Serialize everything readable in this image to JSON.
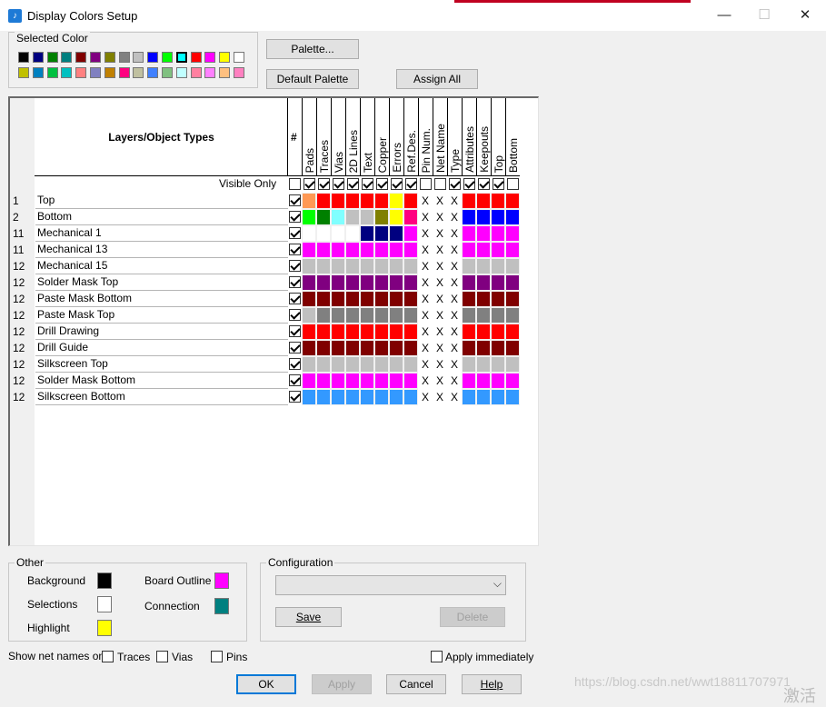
{
  "window": {
    "title": "Display Colors Setup",
    "minimize": "—",
    "maximize": "☐",
    "close": "✕"
  },
  "selected_color": {
    "label": "Selected Color",
    "row1": [
      "#000000",
      "#000080",
      "#008000",
      "#008080",
      "#800000",
      "#800080",
      "#808000",
      "#808080",
      "#c0c0c0",
      "#0000ff",
      "#00ff00",
      "#00ffff",
      "#ff0000",
      "#ff00ff",
      "#ffff00",
      "#ffffff"
    ],
    "row2": [
      "#c0c000",
      "#0080c0",
      "#00c040",
      "#00c0c0",
      "#ff8080",
      "#8080c0",
      "#c08000",
      "#ff0080",
      "#c0c0a0",
      "#4080ff",
      "#80c080",
      "#c0ffff",
      "#ff80a0",
      "#ff80ff",
      "#ffc080",
      "#ff80c0"
    ],
    "selected_index": 11
  },
  "buttons": {
    "palette": "Palette...",
    "default_palette": "Default Palette",
    "assign_all": "Assign All",
    "ok": "OK",
    "apply": "Apply",
    "cancel": "Cancel",
    "help": "Help",
    "save": "Save",
    "delete": "Delete"
  },
  "grid": {
    "header": "Layers/Object Types",
    "hash_col": "#",
    "columns": [
      "Pads",
      "Traces",
      "Vias",
      "2D Lines",
      "Text",
      "Copper",
      "Errors",
      "Ref.Des.",
      "Pin Num.",
      "Net Name",
      "Type",
      "Attributes",
      "Keepouts",
      "Top",
      "Bottom"
    ],
    "visible_only_label": "Visible Only",
    "visible_only_checks": [
      false,
      true,
      true,
      true,
      true,
      true,
      true,
      true,
      true,
      false,
      false,
      true,
      true,
      true,
      true,
      false
    ],
    "rows": [
      {
        "num": "1",
        "name": "Top",
        "checked": true,
        "colors": [
          "#ff9955",
          "#ff0000",
          "#ff0000",
          "#ff0000",
          "#ff0000",
          "#ff0000",
          "#ffff00",
          "#ff0000",
          "X",
          "X",
          "X",
          "#ff0000",
          "#ff0000",
          "#ff0000",
          "#ff0000"
        ]
      },
      {
        "num": "2",
        "name": "Bottom",
        "checked": true,
        "colors": [
          "#00ff00",
          "#008000",
          "#80ffff",
          "#c0c0c0",
          "#c0c0c0",
          "#808000",
          "#ffff00",
          "#ff0080",
          "X",
          "X",
          "X",
          "#0000ff",
          "#0000ff",
          "#0000ff",
          "#0000ff"
        ]
      },
      {
        "num": "11",
        "name": "Mechanical 1",
        "checked": true,
        "colors": [
          "#ffffff",
          "#ffffff",
          "#ffffff",
          "#ffffff",
          "#000080",
          "#000080",
          "#000080",
          "#ff00ff",
          "X",
          "X",
          "X",
          "#ff00ff",
          "#ff00ff",
          "#ff00ff",
          "#ff00ff"
        ]
      },
      {
        "num": "11",
        "name": "Mechanical 13",
        "checked": true,
        "colors": [
          "#ff00ff",
          "#ff00ff",
          "#ff00ff",
          "#ff00ff",
          "#ff00ff",
          "#ff00ff",
          "#ff00ff",
          "#ff00ff",
          "X",
          "X",
          "X",
          "#ff00ff",
          "#ff00ff",
          "#ff00ff",
          "#ff00ff"
        ]
      },
      {
        "num": "12",
        "name": "Mechanical 15",
        "checked": true,
        "colors": [
          "#c0c0c0",
          "#c0c0c0",
          "#c0c0c0",
          "#c0c0c0",
          "#c0c0c0",
          "#c0c0c0",
          "#c0c0c0",
          "#c0c0c0",
          "X",
          "X",
          "X",
          "#c0c0c0",
          "#c0c0c0",
          "#c0c0c0",
          "#c0c0c0"
        ]
      },
      {
        "num": "12",
        "name": "Solder Mask Top",
        "checked": true,
        "colors": [
          "#800080",
          "#800080",
          "#800080",
          "#800080",
          "#800080",
          "#800080",
          "#800080",
          "#800080",
          "X",
          "X",
          "X",
          "#800080",
          "#800080",
          "#800080",
          "#800080"
        ]
      },
      {
        "num": "12",
        "name": "Paste Mask Bottom",
        "checked": true,
        "colors": [
          "#800000",
          "#800000",
          "#800000",
          "#800000",
          "#800000",
          "#800000",
          "#800000",
          "#800000",
          "X",
          "X",
          "X",
          "#800000",
          "#800000",
          "#800000",
          "#800000"
        ]
      },
      {
        "num": "12",
        "name": "Paste Mask Top",
        "checked": true,
        "colors": [
          "#c0c0c0",
          "#808080",
          "#808080",
          "#808080",
          "#808080",
          "#808080",
          "#808080",
          "#808080",
          "X",
          "X",
          "X",
          "#808080",
          "#808080",
          "#808080",
          "#808080"
        ]
      },
      {
        "num": "12",
        "name": "Drill Drawing",
        "checked": true,
        "colors": [
          "#ff0000",
          "#ff0000",
          "#ff0000",
          "#ff0000",
          "#ff0000",
          "#ff0000",
          "#ff0000",
          "#ff0000",
          "X",
          "X",
          "X",
          "#ff0000",
          "#ff0000",
          "#ff0000",
          "#ff0000"
        ]
      },
      {
        "num": "12",
        "name": "Drill Guide",
        "checked": true,
        "colors": [
          "#800000",
          "#800000",
          "#800000",
          "#800000",
          "#800000",
          "#800000",
          "#800000",
          "#800000",
          "X",
          "X",
          "X",
          "#800000",
          "#800000",
          "#800000",
          "#800000"
        ]
      },
      {
        "num": "12",
        "name": "Silkscreen Top",
        "checked": true,
        "colors": [
          "#c0c0c0",
          "#c0c0c0",
          "#c0c0c0",
          "#c0c0c0",
          "#c0c0c0",
          "#c0c0c0",
          "#c0c0c0",
          "#c0c0c0",
          "X",
          "X",
          "X",
          "#c0c0c0",
          "#c0c0c0",
          "#c0c0c0",
          "#c0c0c0"
        ]
      },
      {
        "num": "12",
        "name": "Solder Mask Bottom",
        "checked": true,
        "colors": [
          "#ff00ff",
          "#ff00ff",
          "#ff00ff",
          "#ff00ff",
          "#ff00ff",
          "#ff00ff",
          "#ff00ff",
          "#ff00ff",
          "X",
          "X",
          "X",
          "#ff00ff",
          "#ff00ff",
          "#ff00ff",
          "#ff00ff"
        ]
      },
      {
        "num": "12",
        "name": "Silkscreen Bottom",
        "checked": true,
        "colors": [
          "#3399ff",
          "#3399ff",
          "#3399ff",
          "#3399ff",
          "#3399ff",
          "#3399ff",
          "#3399ff",
          "#3399ff",
          "X",
          "X",
          "X",
          "#3399ff",
          "#3399ff",
          "#3399ff",
          "#3399ff"
        ]
      }
    ]
  },
  "other": {
    "label": "Other",
    "items": [
      {
        "label": "Background",
        "color": "#000000"
      },
      {
        "label": "Selections",
        "color": "#ffffff"
      },
      {
        "label": "Highlight",
        "color": "#ffff00"
      },
      {
        "label": "Board Outline",
        "color": "#ff00ff"
      },
      {
        "label": "Connection",
        "color": "#008080"
      }
    ]
  },
  "configuration": {
    "label": "Configuration",
    "value": ""
  },
  "net_names": {
    "label": "Show net names on",
    "traces": "Traces",
    "vias": "Vias",
    "pins": "Pins",
    "apply_immediately": "Apply immediately"
  },
  "watermark": {
    "text": "https://blog.csdn.net/wwt18811707971",
    "corner": "激活"
  }
}
